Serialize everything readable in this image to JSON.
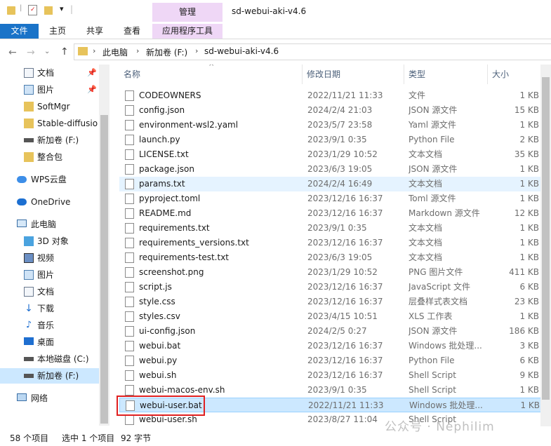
{
  "window": {
    "title": "sd-webui-aki-v4.6",
    "context_tab": "管理"
  },
  "ribbon": {
    "tabs": [
      "文件",
      "主页",
      "共享",
      "查看",
      "应用程序工具"
    ]
  },
  "address": {
    "crumbs": [
      "此电脑",
      "新加卷 (F:)",
      "sd-webui-aki-v4.6"
    ]
  },
  "nav": {
    "items": [
      {
        "label": "文档",
        "icon": "document-icon",
        "pinned": true
      },
      {
        "label": "图片",
        "icon": "pictures-icon",
        "pinned": true
      },
      {
        "label": "SoftMgr",
        "icon": "folder-icon",
        "pinned": false
      },
      {
        "label": "Stable-diffusion",
        "icon": "folder-icon",
        "pinned": false
      },
      {
        "label": "新加卷 (F:)",
        "icon": "drive-icon",
        "pinned": false
      },
      {
        "label": "整合包",
        "icon": "folder-icon",
        "pinned": false
      },
      {
        "label": "WPS云盘",
        "icon": "cloud-icon",
        "pinned": false
      },
      {
        "label": "OneDrive",
        "icon": "onedrive-icon",
        "pinned": false
      },
      {
        "label": "此电脑",
        "icon": "computer-icon",
        "pinned": false
      },
      {
        "label": "3D 对象",
        "icon": "3d-objects-icon",
        "pinned": false
      },
      {
        "label": "视频",
        "icon": "video-icon",
        "pinned": false
      },
      {
        "label": "图片",
        "icon": "pictures-icon",
        "pinned": false
      },
      {
        "label": "文档",
        "icon": "document-icon",
        "pinned": false
      },
      {
        "label": "下载",
        "icon": "download-icon",
        "pinned": false
      },
      {
        "label": "音乐",
        "icon": "music-icon",
        "pinned": false
      },
      {
        "label": "桌面",
        "icon": "desktop-icon",
        "pinned": false
      },
      {
        "label": "本地磁盘 (C:)",
        "icon": "drive-icon",
        "pinned": false
      },
      {
        "label": "新加卷 (F:)",
        "icon": "drive-icon",
        "pinned": false
      },
      {
        "label": "网络",
        "icon": "network-icon",
        "pinned": false
      }
    ]
  },
  "columns": {
    "name": "名称",
    "date": "修改日期",
    "type": "类型",
    "size": "大小"
  },
  "files": [
    {
      "name": "CODEOWNERS",
      "date": "2022/11/21 11:33",
      "type": "文件",
      "size": "1 KB"
    },
    {
      "name": "config.json",
      "date": "2024/2/4 21:03",
      "type": "JSON 源文件",
      "size": "15 KB"
    },
    {
      "name": "environment-wsl2.yaml",
      "date": "2023/5/7 23:58",
      "type": "Yaml 源文件",
      "size": "1 KB"
    },
    {
      "name": "launch.py",
      "date": "2023/9/1 0:35",
      "type": "Python File",
      "size": "2 KB"
    },
    {
      "name": "LICENSE.txt",
      "date": "2023/1/29 10:52",
      "type": "文本文档",
      "size": "35 KB"
    },
    {
      "name": "package.json",
      "date": "2023/6/3 19:05",
      "type": "JSON 源文件",
      "size": "1 KB"
    },
    {
      "name": "params.txt",
      "date": "2024/2/4 16:49",
      "type": "文本文档",
      "size": "1 KB"
    },
    {
      "name": "pyproject.toml",
      "date": "2023/12/16 16:37",
      "type": "Toml 源文件",
      "size": "1 KB"
    },
    {
      "name": "README.md",
      "date": "2023/12/16 16:37",
      "type": "Markdown 源文件",
      "size": "12 KB"
    },
    {
      "name": "requirements.txt",
      "date": "2023/9/1 0:35",
      "type": "文本文档",
      "size": "1 KB"
    },
    {
      "name": "requirements_versions.txt",
      "date": "2023/12/16 16:37",
      "type": "文本文档",
      "size": "1 KB"
    },
    {
      "name": "requirements-test.txt",
      "date": "2023/6/3 19:05",
      "type": "文本文档",
      "size": "1 KB"
    },
    {
      "name": "screenshot.png",
      "date": "2023/1/29 10:52",
      "type": "PNG 图片文件",
      "size": "411 KB"
    },
    {
      "name": "script.js",
      "date": "2023/12/16 16:37",
      "type": "JavaScript 文件",
      "size": "6 KB"
    },
    {
      "name": "style.css",
      "date": "2023/12/16 16:37",
      "type": "层叠样式表文档",
      "size": "23 KB"
    },
    {
      "name": "styles.csv",
      "date": "2023/4/15 10:51",
      "type": "XLS 工作表",
      "size": "1 KB"
    },
    {
      "name": "ui-config.json",
      "date": "2024/2/5 0:27",
      "type": "JSON 源文件",
      "size": "186 KB"
    },
    {
      "name": "webui.bat",
      "date": "2023/12/16 16:37",
      "type": "Windows 批处理...",
      "size": "3 KB"
    },
    {
      "name": "webui.py",
      "date": "2023/12/16 16:37",
      "type": "Python File",
      "size": "6 KB"
    },
    {
      "name": "webui.sh",
      "date": "2023/12/16 16:37",
      "type": "Shell Script",
      "size": "9 KB"
    },
    {
      "name": "webui-macos-env.sh",
      "date": "2023/9/1 0:35",
      "type": "Shell Script",
      "size": "1 KB"
    },
    {
      "name": "webui-user.bat",
      "date": "2022/11/21 11:33",
      "type": "Windows 批处理...",
      "size": "1 KB"
    },
    {
      "name": "webui-user.sh",
      "date": "2023/8/27 11:04",
      "type": "Shell Script",
      "size": ""
    }
  ],
  "status": {
    "count": "58 个项目",
    "selection": "选中 1 个项目",
    "size": "92 字节"
  },
  "watermark": "公众号 · Nephilim",
  "colors": {
    "selected_row": "#cce8ff",
    "hover_row": "#e5f3ff",
    "file_tab": "#1a73c8",
    "manage_tab": "#efd7f6",
    "highlight_box": "#e02020"
  }
}
